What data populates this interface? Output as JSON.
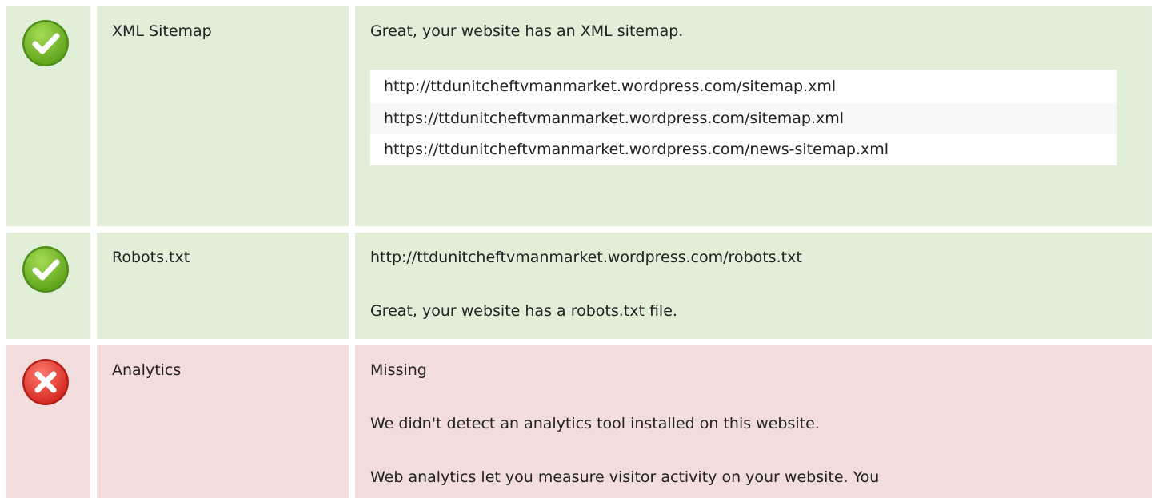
{
  "colors": {
    "pass_bg": "#e1efd9",
    "fail_bg": "#f2dcdc",
    "pass_icon": "#7cbf2e",
    "fail_icon": "#e53935"
  },
  "rows": {
    "sitemap": {
      "status": "pass",
      "icon": "check-icon",
      "label": "XML Sitemap",
      "message": "Great, your website has an XML sitemap.",
      "urls": [
        "http://ttdunitcheftvmanmarket.wordpress.com/sitemap.xml",
        "https://ttdunitcheftvmanmarket.wordpress.com/sitemap.xml",
        "https://ttdunitcheftvmanmarket.wordpress.com/news-sitemap.xml"
      ]
    },
    "robots": {
      "status": "pass",
      "icon": "check-icon",
      "label": "Robots.txt",
      "url": "http://ttdunitcheftvmanmarket.wordpress.com/robots.txt",
      "message": "Great, your website has a robots.txt file."
    },
    "analytics": {
      "status": "fail",
      "icon": "cross-icon",
      "label": "Analytics",
      "state": "Missing",
      "message": "We didn't detect an analytics tool installed on this website.",
      "description": "Web analytics let you measure visitor activity on your website. You"
    }
  }
}
